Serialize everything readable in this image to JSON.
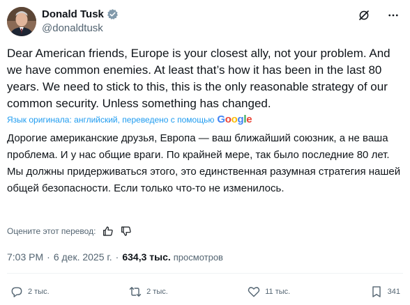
{
  "author": {
    "name": "Donald Tusk",
    "handle": "@donaldtusk"
  },
  "post": {
    "text_en": "Dear American friends, Europe is your closest ally, not your problem. And we have common enemies. At least that’s how it has been in the last 80 years. We need to stick to this, this is the only reasonable strategy of our common security. Unless something has changed.",
    "translation_note": "Язык оригинала: английский, переведено с помощью",
    "translation_provider": "Google",
    "text_ru": "Дорогие американские друзья, Европа — ваш ближайший союзник, а не ваша проблема. И у нас общие враги. По крайней мере, так было последние 80 лет. Мы должны придерживаться этого, это единственная разумная стратегия нашей общей безопасности. Если только что-то не изменилось.",
    "rate_translation": "Оцените этот перевод:",
    "time": "7:03 PM",
    "date": "6 дек. 2025 г.",
    "separator": "·",
    "views_count": "634,3 тыс.",
    "views_label": "просмотров"
  },
  "actions": {
    "replies": "2 тыс.",
    "reposts": "2 тыс.",
    "likes": "11 тыс.",
    "bookmarks": "341"
  },
  "colors": {
    "text": "#0f1419",
    "secondary": "#536471",
    "link": "#1d9bf0",
    "verified": "#829aab"
  },
  "icons": [
    "verified-badge-icon",
    "grok-icon",
    "more-icon",
    "thumbs-up-icon",
    "thumbs-down-icon",
    "reply-icon",
    "repost-icon",
    "like-icon",
    "bookmark-icon",
    "google-logo"
  ]
}
